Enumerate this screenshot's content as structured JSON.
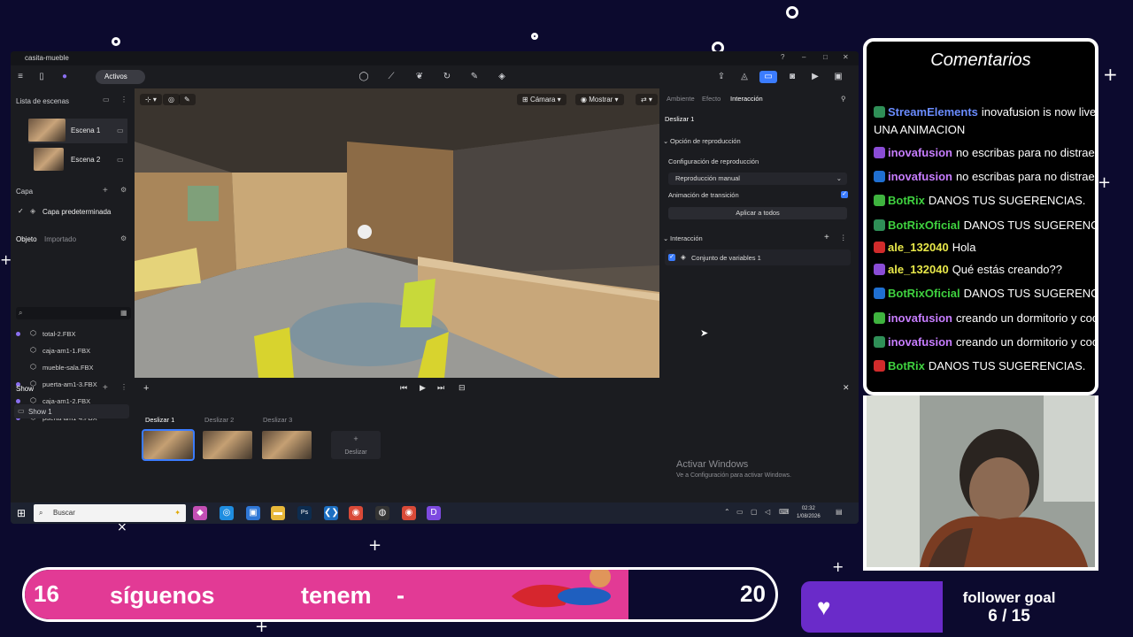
{
  "app": {
    "title": "casita-mueble",
    "mode": "Activos"
  },
  "left_panel": {
    "scenes_title": "Lista de escenas",
    "scenes": [
      {
        "label": "Escena 1"
      },
      {
        "label": "Escena 2"
      }
    ],
    "layer_title": "Capa",
    "layer_item": "Capa predeterminada",
    "object_tab": "Objeto",
    "imported_tab": "Importado",
    "objects": [
      {
        "name": "total-2.FBX"
      },
      {
        "name": "caja-am1-1.FBX"
      },
      {
        "name": "mueble-sala.FBX"
      },
      {
        "name": "puerta-am1-3.FBX"
      },
      {
        "name": "caja-am1-2.FBX"
      },
      {
        "name": "puerta-am1-4.FBX"
      }
    ],
    "show_title": "Show",
    "show_item": "Show 1"
  },
  "viewport": {
    "camera_label": "Cámara",
    "show_label": "Mostrar"
  },
  "right_panel": {
    "tabs": [
      "Ambiente",
      "Efecto",
      "Interacción"
    ],
    "active_tab": "Interacción",
    "slide_title": "Deslizar 1",
    "playback_option": "Opción de reproducción",
    "playback_config": "Configuración de reproducción",
    "playback_mode": "Reproducción manual",
    "transition_anim": "Animación de transición",
    "apply_all": "Aplicar a todos",
    "interaction_title": "Interacción",
    "variable_set": "Conjunto de variables 1"
  },
  "timeline": {
    "slides": [
      {
        "label": "Deslizar 1"
      },
      {
        "label": "Deslizar 2"
      },
      {
        "label": "Deslizar 3"
      }
    ],
    "add_label": "Deslizar",
    "activate_title": "Activar Windows",
    "activate_sub": "Ve a Configuración para activar Windows."
  },
  "taskbar": {
    "search_placeholder": "Buscar",
    "time": "02:32",
    "date": "1/08/2026"
  },
  "chat": {
    "title": "Comentarios",
    "messages": [
      {
        "user": "StreamElements",
        "text": "inovafusion is now live! UNA ANIMACION",
        "user_color": "#6a8cff"
      },
      {
        "user": "",
        "text": "UNA ANIMACION",
        "user_color": "#ffffff"
      },
      {
        "user": "inovafusion",
        "text": "no escribas para no distraer",
        "user_color": "#c77dff"
      },
      {
        "user": "inovafusion",
        "text": "no escribas para no distraer",
        "user_color": "#c77dff"
      },
      {
        "user": "BotRix",
        "text": "DANOS TUS SUGERENCIAS.",
        "user_color": "#3fd13f"
      },
      {
        "user": "BotRixOficial",
        "text": "DANOS TUS SUGERENCIAS.",
        "user_color": "#3fd13f"
      },
      {
        "user": "ale_132040",
        "text": "Hola",
        "user_color": "#e8e84a"
      },
      {
        "user": "ale_132040",
        "text": "Qué estás creando??",
        "user_color": "#e8e84a"
      },
      {
        "user": "BotRixOficial",
        "text": "DANOS TUS SUGERENCIAS.",
        "user_color": "#3fd13f"
      },
      {
        "user": "inovafusion",
        "text": "creando un dormitorio y cocina",
        "user_color": "#c77dff"
      },
      {
        "user": "inovafusion",
        "text": "creando un dormitorio y cocina",
        "user_color": "#c77dff"
      },
      {
        "user": "BotRix",
        "text": "DANOS TUS SUGERENCIAS.",
        "user_color": "#3fd13f"
      }
    ]
  },
  "ticker": {
    "left_number": "16",
    "right_number": "20",
    "text1": "síguenos",
    "text2": "tenem",
    "text3": "-"
  },
  "follower_goal": {
    "label": "follower goal",
    "progress": "6 / 15"
  },
  "colors": {
    "accent": "#3b7cff",
    "ticker": "#e23a95",
    "goal": "#6a2bc9"
  }
}
